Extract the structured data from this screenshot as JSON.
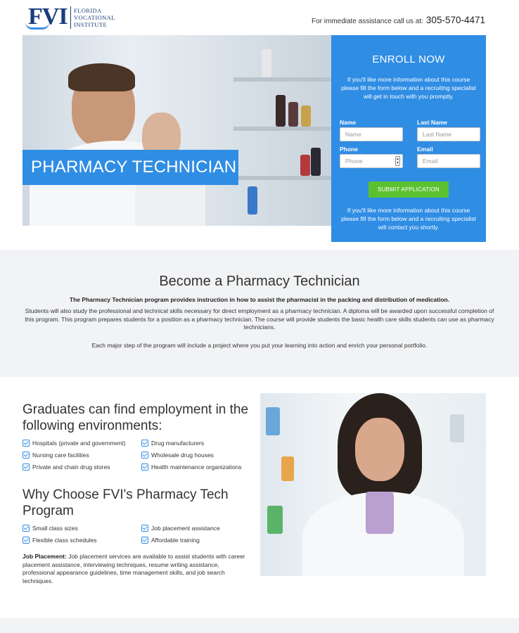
{
  "header": {
    "logo_mark": "FVI",
    "logo_line1": "FLORIDA",
    "logo_line2": "VOCATIONAL",
    "logo_line3": "INSTITUTE",
    "assist_text": "For immediate assistance call us at:",
    "phone": "305-570-4471"
  },
  "hero": {
    "title": "PHARMACY TECHNICIAN"
  },
  "enroll": {
    "heading": "ENROLL NOW",
    "intro": "If you'll like more information about this course please fill the form below and a recruiting specialist will get in touch with you promptly.",
    "fields": {
      "name_label": "Name",
      "name_placeholder": "Name",
      "last_name_label": "Last Name",
      "last_name_placeholder": "Last Name",
      "phone_label": "Phone",
      "phone_placeholder": "Phone",
      "email_label": "Email",
      "email_placeholder": "Email"
    },
    "submit_label": "SUBMIT APPLICATION",
    "outro": "If you'll like more information about this course please fill the form below and a recruiting specialist will contact you shortly."
  },
  "about": {
    "heading": "Become a Pharmacy Technician",
    "lead": "The Pharmacy Technician program provides instruction in how to assist the pharmacist in the packing and distribution of medication.",
    "para1": "Students will also study the professional and technical skills necessary for direct employment as a pharmacy technician. A diploma will be awarded upon successful completion of this program. This program prepares students for a position as a pharmacy technician. The course will provide students the basic health care skills students can use as pharmacy technicians.",
    "para2": "Each major step of the program will include a project where you put your learning into action and enrich your personal portfolio."
  },
  "employment": {
    "heading": "Graduates can find employment in the following environments:",
    "items": [
      "Hospitals (private and government)",
      "Drug manufacturers",
      "Nursing care facilities",
      "Wholesale drug houses",
      "Private and chain drug stores",
      "Health maintenance organizations"
    ]
  },
  "why": {
    "heading": "Why Choose FVI's Pharmacy Tech Program",
    "items": [
      "Small class sizes",
      "Job placement assistance",
      "Flexible class schedules",
      "Affordable training"
    ]
  },
  "job_placement": {
    "label": "Job Placement:",
    "text": " Job placement services are available to assist students with career placement assistance, interviewing techniques, resume writing assistance, professional appearance guidelines, time management skills, and job search techniques."
  },
  "colors": {
    "accent_blue": "#2f8de4",
    "submit_green": "#5cc131",
    "logo_navy": "#1a3d7c"
  }
}
